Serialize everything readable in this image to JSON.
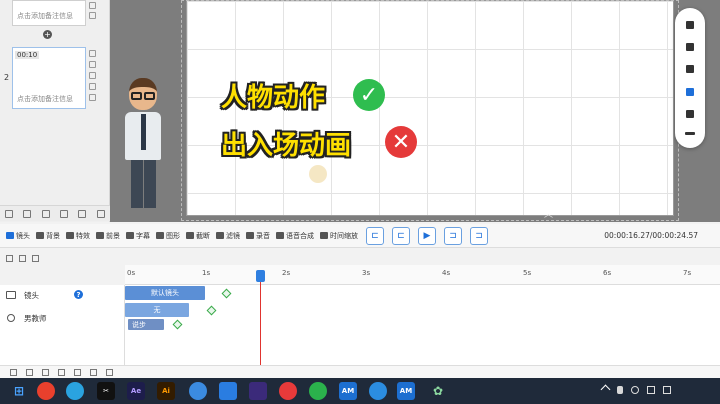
{
  "slides": [
    {
      "number": "",
      "note": "点击添加备注信息"
    },
    {
      "number": "2",
      "time": "00:10",
      "note": "点击添加备注信息"
    }
  ],
  "canvas": {
    "line1": "人物动作",
    "line2": "出入场动画",
    "check_icon": "check-circle-icon",
    "cross_icon": "x-circle-icon",
    "check_color": "#2fbd4f",
    "cross_color": "#e53a3a"
  },
  "toolbar": {
    "items": [
      "镜头",
      "背景",
      "特效",
      "前景",
      "字幕",
      "图形",
      "截断",
      "滤镜",
      "录音",
      "语音合成",
      "时间缩放"
    ],
    "time": "00:00:16.27/00:00:24.57"
  },
  "ruler_ticks": [
    "0s",
    "1s",
    "2s",
    "3s",
    "4s",
    "5s",
    "6s",
    "7s"
  ],
  "tracks": [
    {
      "label": "镜头",
      "clip": "默认镜头"
    },
    {
      "label": "男教师",
      "clip": "无",
      "clip2": "说步"
    }
  ],
  "colors": {
    "accent": "#1e6fd9",
    "playhead": "#e0342f",
    "clip_blue": "#5b8fd6"
  }
}
